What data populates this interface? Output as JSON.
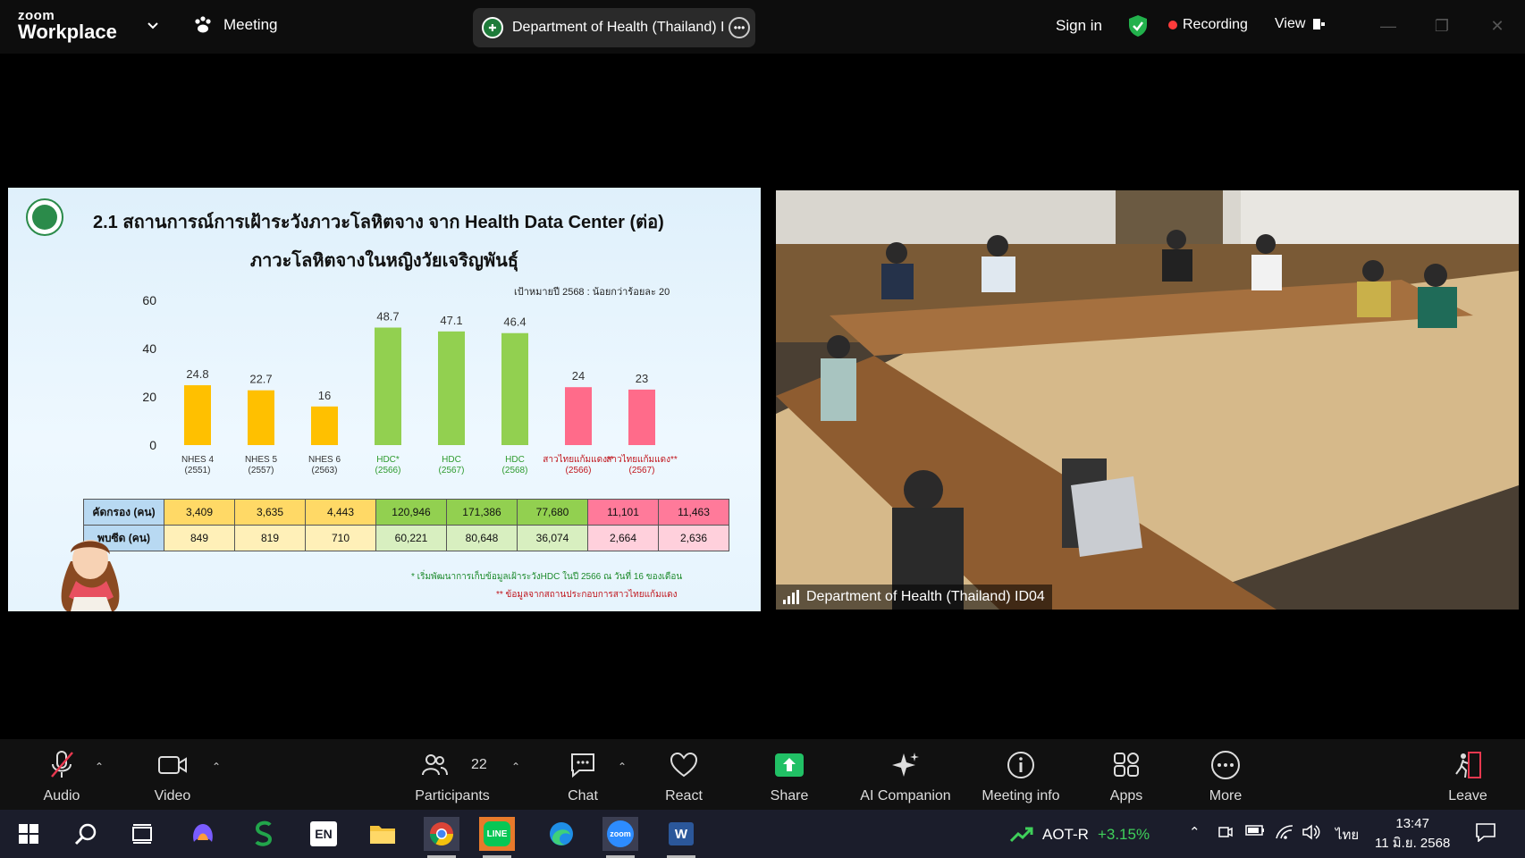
{
  "titlebar": {
    "logo_top": "zoom",
    "logo_bottom": "Workplace",
    "meeting_label": "Meeting",
    "pill_title": "Department of Health (Thailand) I",
    "sign_in": "Sign in",
    "recording": "Recording",
    "view": "View"
  },
  "slide": {
    "title": "2.1  สถานการณ์การเฝ้าระวังภาวะโลหิตจาง จาก Health Data Center (ต่อ)",
    "subtitle": "ภาวะโลหิตจางในหญิงวัยเจริญพันธุ์",
    "target": "เป้าหมายปี 2568 : น้อยกว่าร้อยละ 20",
    "table": {
      "rows": [
        {
          "label": "คัดกรอง (คน)",
          "values": [
            "3,409",
            "3,635",
            "4,443",
            "120,946",
            "171,386",
            "77,680",
            "11,101",
            "11,463"
          ]
        },
        {
          "label": "พบซีด (คน)",
          "values": [
            "849",
            "819",
            "710",
            "60,221",
            "80,648",
            "36,074",
            "2,664",
            "2,636"
          ]
        }
      ]
    },
    "note1": "* เริ่มพัฒนาการเก็บข้อมูลเฝ้าระวังHDC ในปี 2566 ณ วันที่ 16 ของเดือน",
    "note2": "** ข้อมูลจากสถานประกอบการสาวไทยแก้มแดง"
  },
  "chart_data": {
    "type": "bar",
    "title": "ภาวะโลหิตจางในหญิงวัยเจริญพันธุ์",
    "categories": [
      [
        "NHES 4",
        "(2551)"
      ],
      [
        "NHES 5",
        "(2557)"
      ],
      [
        "NHES 6",
        "(2563)"
      ],
      [
        "HDC*",
        "(2566)"
      ],
      [
        "HDC",
        "(2567)"
      ],
      [
        "HDC",
        "(2568)"
      ],
      [
        "สาวไทยแก้มแดง**",
        "(2566)"
      ],
      [
        "สาวไทยแก้มแดง**",
        "(2567)"
      ]
    ],
    "values": [
      24.8,
      22.7,
      16,
      48.7,
      47.1,
      46.4,
      24,
      23
    ],
    "value_labels": [
      "24.8",
      "22.7",
      "16",
      "48.7",
      "47.1",
      "46.4",
      "24",
      "23"
    ],
    "colors": [
      "#ffc000",
      "#ffc000",
      "#ffc000",
      "#92d050",
      "#92d050",
      "#92d050",
      "#ff6b8a",
      "#ff6b8a"
    ],
    "label_colors": [
      "#333333",
      "#333333",
      "#333333",
      "#2e9b2e",
      "#2e9b2e",
      "#2e9b2e",
      "#c0151c",
      "#c0151c"
    ],
    "yticks": [
      "60",
      "40",
      "20",
      "0"
    ],
    "ylim": [
      0,
      60
    ],
    "grid": false,
    "legend": "none"
  },
  "video": {
    "name": "Department of Health (Thailand) ID04"
  },
  "toolbar": {
    "audio": "Audio",
    "video": "Video",
    "participants": "Participants",
    "participants_count": "22",
    "chat": "Chat",
    "react": "React",
    "share": "Share",
    "ai": "AI Companion",
    "info": "Meeting info",
    "apps": "Apps",
    "more": "More",
    "leave": "Leave"
  },
  "taskbar": {
    "lang_badge": "EN",
    "ticker_name": "AOT-R",
    "ticker_pct": "+3.15%",
    "ime": "ไทย",
    "time": "13:47",
    "date": "11 มิ.ย. 2568",
    "zoom_label": "zoom"
  },
  "colors": {
    "accent_green": "#3fcf5a",
    "share_green": "#21c065",
    "recording_red": "#ff3b3b"
  }
}
